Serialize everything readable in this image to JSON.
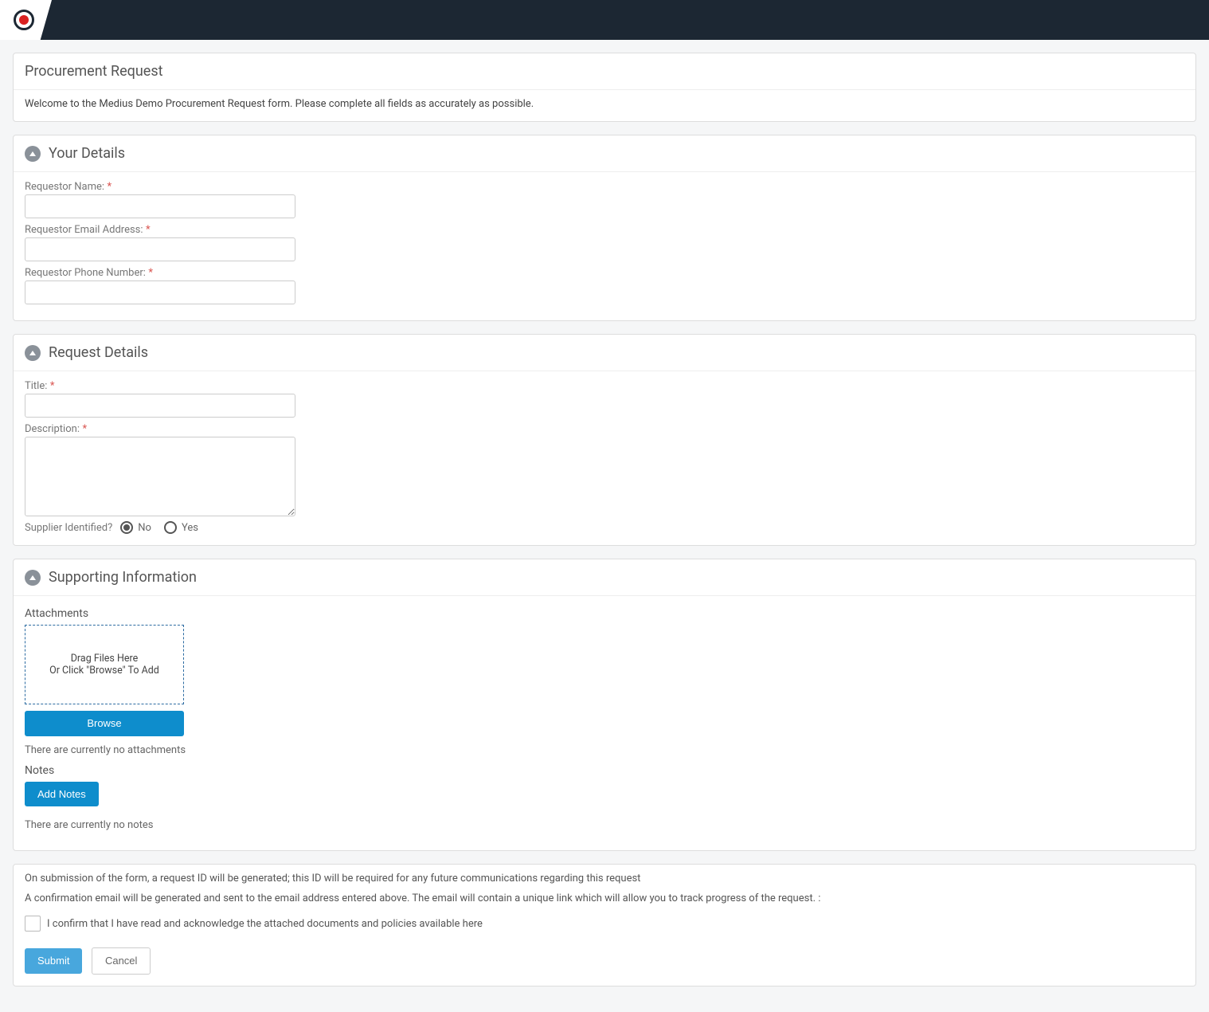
{
  "header": {
    "page_title": "Procurement Request",
    "intro_text": "Welcome to the Medius Demo Procurement Request form. Please complete all fields as accurately as possible."
  },
  "your_details": {
    "section_title": "Your Details",
    "requestor_name_label": "Requestor Name:",
    "requestor_name_value": "",
    "requestor_email_label": "Requestor Email Address:",
    "requestor_email_value": "",
    "requestor_phone_label": "Requestor Phone Number:",
    "requestor_phone_value": ""
  },
  "request_details": {
    "section_title": "Request Details",
    "title_label": "Title:",
    "title_value": "",
    "description_label": "Description:",
    "description_value": "",
    "supplier_identified_label": "Supplier Identified?",
    "option_no": "No",
    "option_yes": "Yes",
    "supplier_identified_selected": "No"
  },
  "supporting_information": {
    "section_title": "Supporting Information",
    "attachments_label": "Attachments",
    "dropzone_line1": "Drag Files Here",
    "dropzone_line2": "Or Click \"Browse\" To Add",
    "browse_label": "Browse",
    "no_attachments_text": "There are currently no attachments",
    "notes_label": "Notes",
    "add_notes_label": "Add Notes",
    "no_notes_text": "There are currently no notes"
  },
  "footer": {
    "line1": "On submission of the form, a request ID will be generated; this ID will be required for any future communications regarding this request",
    "line2": "A confirmation email will be generated and sent to the email address entered above. The email will contain a unique link which will allow you to track progress of the request. :",
    "confirm_text": "I confirm that I have read and acknowledge the attached documents and policies available ",
    "here_link": "here",
    "submit_label": "Submit",
    "cancel_label": "Cancel"
  },
  "required_marker": "*"
}
